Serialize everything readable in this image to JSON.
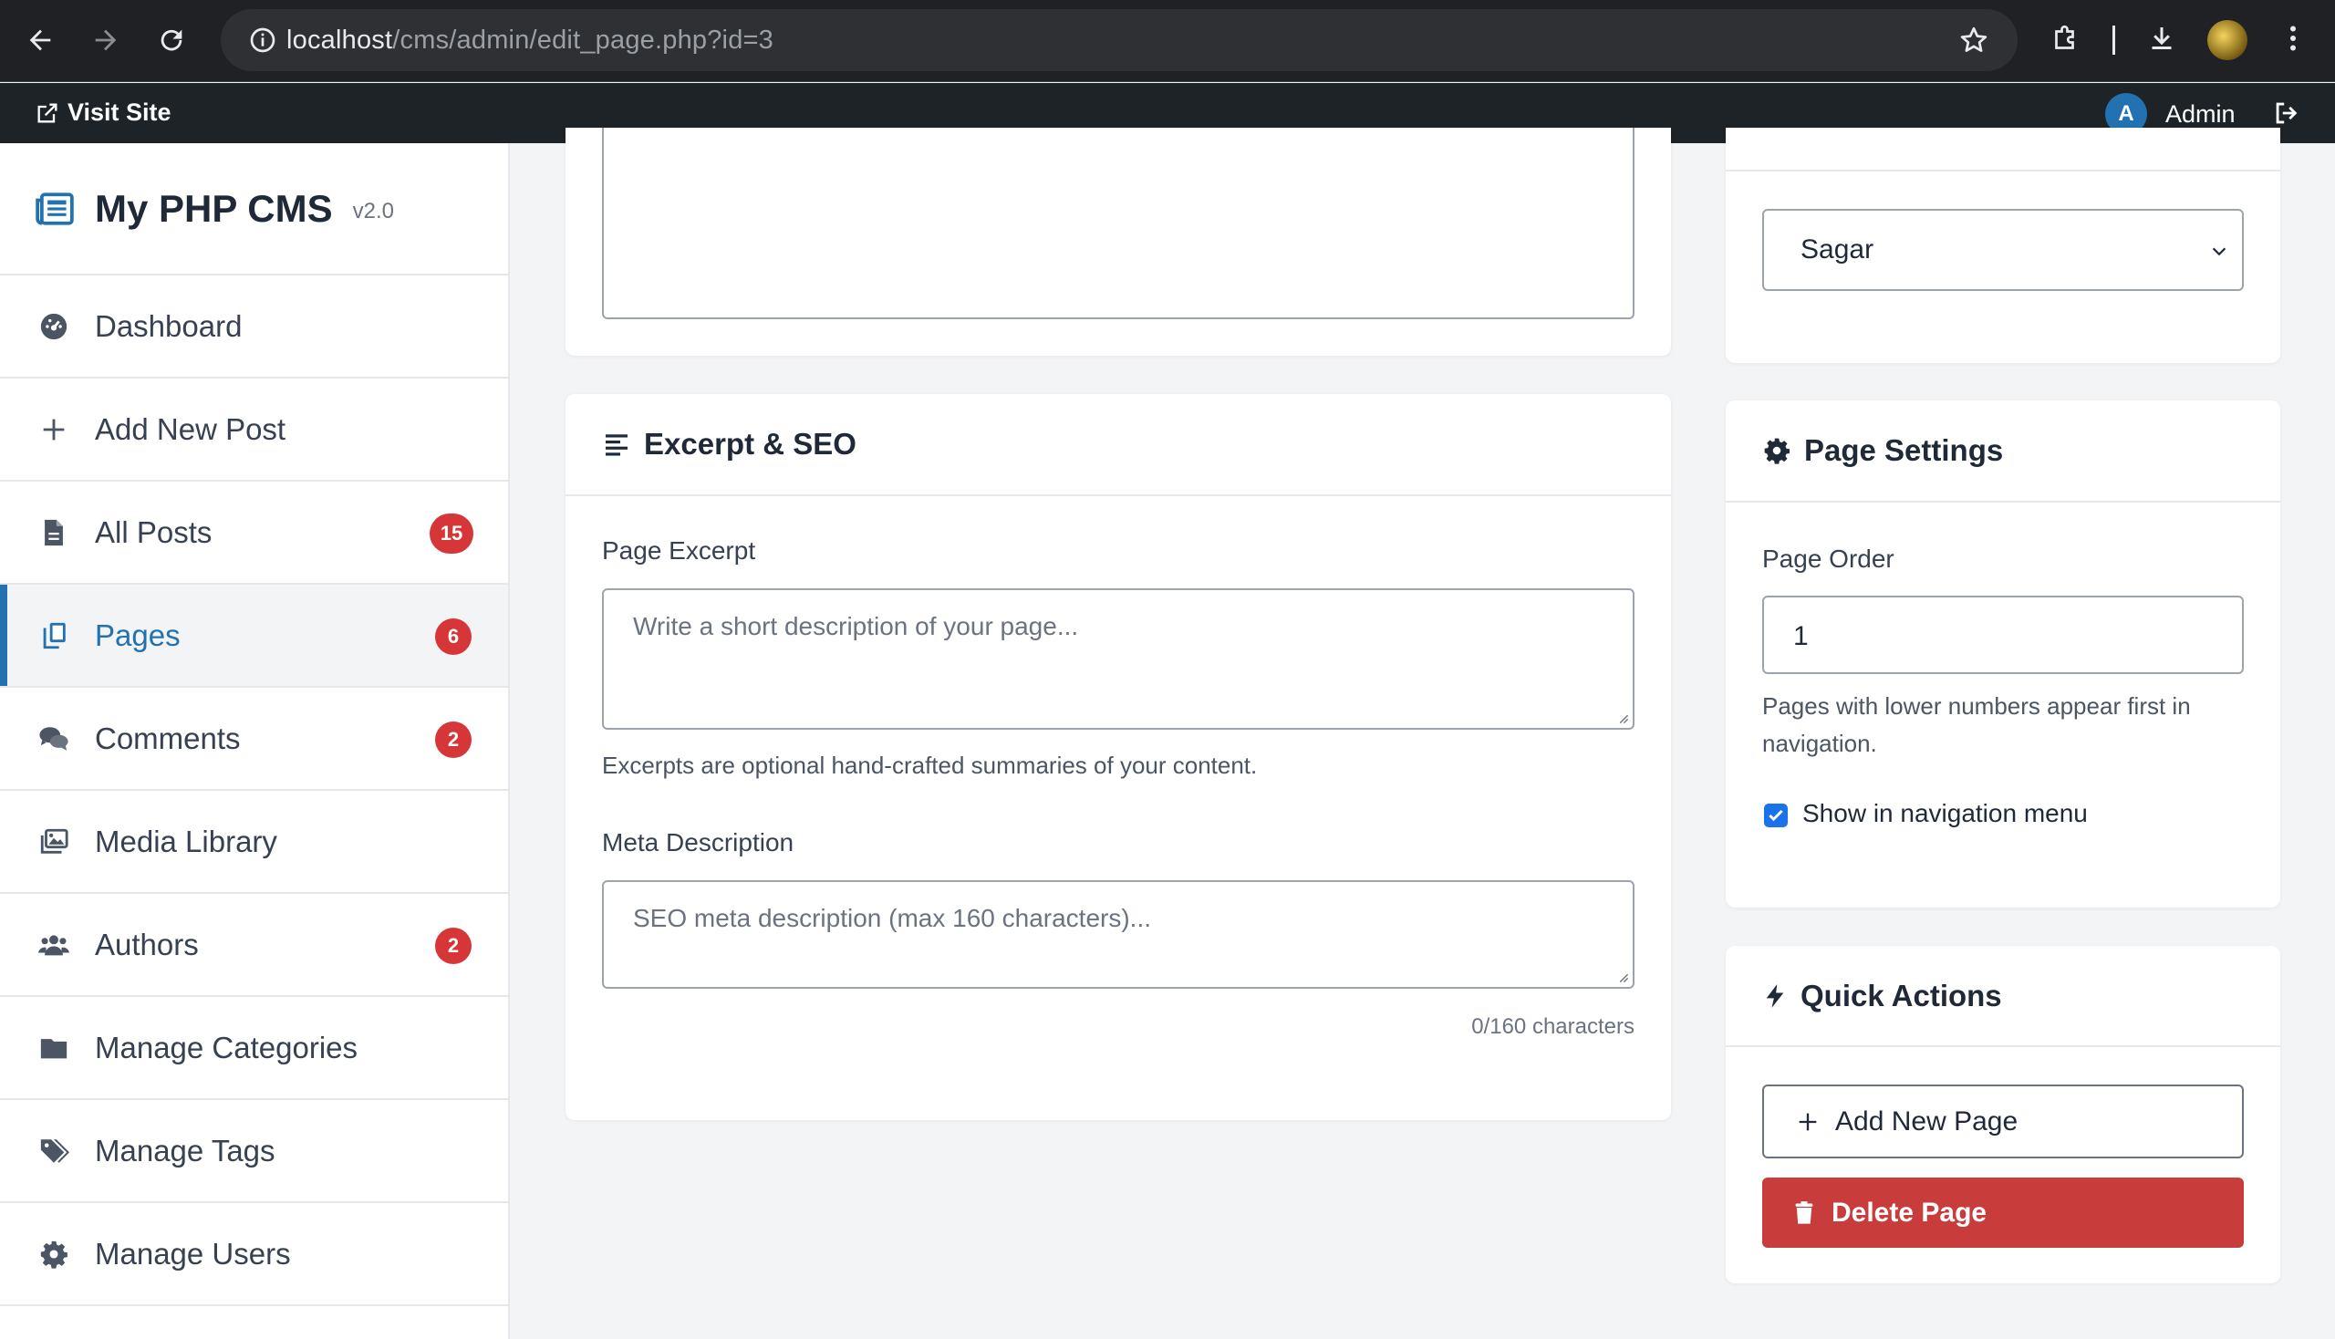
{
  "browser": {
    "url_host": "localhost",
    "url_path": "/cms/admin/edit_page.php?id=3"
  },
  "adminbar": {
    "visit_site": "Visit Site",
    "avatar_letter": "A",
    "user_name": "Admin"
  },
  "sidebar": {
    "brand_name": "My PHP CMS",
    "brand_version": "v2.0",
    "items": [
      {
        "label": "Dashboard",
        "icon": "dashboard-icon"
      },
      {
        "label": "Add New Post",
        "icon": "plus-icon"
      },
      {
        "label": "All Posts",
        "icon": "file-icon",
        "badge": "15"
      },
      {
        "label": "Pages",
        "icon": "copy-icon",
        "badge": "6",
        "active": true
      },
      {
        "label": "Comments",
        "icon": "comments-icon",
        "badge": "2"
      },
      {
        "label": "Media Library",
        "icon": "images-icon"
      },
      {
        "label": "Authors",
        "icon": "users-icon",
        "badge": "2"
      },
      {
        "label": "Manage Categories",
        "icon": "folder-icon"
      },
      {
        "label": "Manage Tags",
        "icon": "tags-icon"
      },
      {
        "label": "Manage Users",
        "icon": "gear-icon"
      }
    ]
  },
  "excerpt_card": {
    "title": "Excerpt & SEO",
    "excerpt_label": "Page Excerpt",
    "excerpt_placeholder": "Write a short description of your page...",
    "excerpt_help": "Excerpts are optional hand-crafted summaries of your content.",
    "meta_label": "Meta Description",
    "meta_placeholder": "SEO meta description (max 160 characters)...",
    "meta_counter": "0/160 characters"
  },
  "author_card": {
    "selected_author": "Sagar"
  },
  "page_settings": {
    "title": "Page Settings",
    "order_label": "Page Order",
    "order_value": "1",
    "order_help_line1": "Pages with lower numbers appear first in",
    "order_help_line2": "navigation.",
    "show_in_nav_label": "Show in navigation menu",
    "show_in_nav_checked": true
  },
  "quick_actions": {
    "title": "Quick Actions",
    "add_label": "Add New Page",
    "delete_label": "Delete Page"
  },
  "colors": {
    "accent": "#2271b1",
    "danger": "#c93c3c",
    "badge": "#d63638",
    "adminbar": "#1d2327"
  }
}
